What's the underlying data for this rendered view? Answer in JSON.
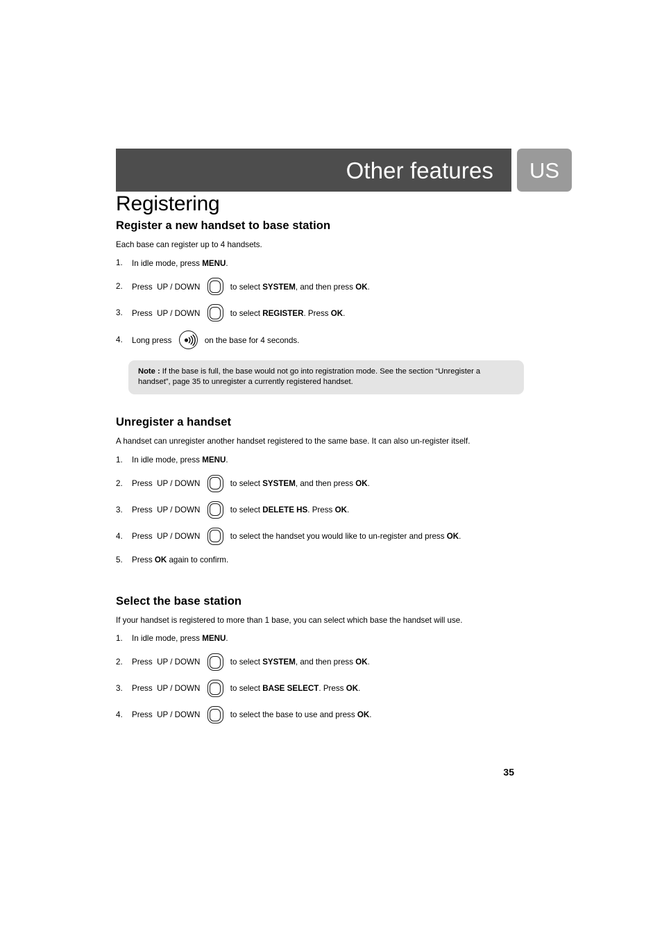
{
  "header": {
    "title": "Other features",
    "region_badge": "US",
    "bar_color": "#4d4d4d",
    "badge_color": "#9a9a9a"
  },
  "chapter_title": "Registering",
  "sections": [
    {
      "heading": "Register a new handset to base station",
      "intro": "Each base can register up to 4 handsets.",
      "steps": [
        {
          "num": "1.",
          "icon": "none",
          "before": "In idle mode, press ",
          "bold1": "MENU",
          "after": "."
        },
        {
          "num": "2.",
          "icon": "navigation-key-icon",
          "before": "Press  UP / DOWN ",
          "mid": " to select ",
          "bold1": "SYSTEM",
          "mid2": ", and then press ",
          "bold2": "OK",
          "after": "."
        },
        {
          "num": "3.",
          "icon": "navigation-key-icon",
          "before": "Press  UP / DOWN ",
          "mid": " to select ",
          "bold1": "REGISTER",
          "mid2": ". Press ",
          "bold2": "OK",
          "after": "."
        },
        {
          "num": "4.",
          "icon": "base-paging-icon",
          "before": "Long press ",
          "mid": " on the base for 4 seconds.",
          "after": ""
        }
      ],
      "note": {
        "label": "Note :",
        "text": " If the base is full, the base would not go into registration mode. See the section “Unregister a handset”, page 35 to unregister a currently registered handset."
      }
    },
    {
      "heading": "Unregister a handset",
      "intro": "A handset can unregister another handset registered to the same base. It can also un-register itself.",
      "steps": [
        {
          "num": "1.",
          "icon": "none",
          "before": "In idle mode, press ",
          "bold1": "MENU",
          "after": "."
        },
        {
          "num": "2.",
          "icon": "navigation-key-icon",
          "before": "Press  UP / DOWN ",
          "mid": " to select ",
          "bold1": "SYSTEM",
          "mid2": ", and then press ",
          "bold2": "OK",
          "after": "."
        },
        {
          "num": "3.",
          "icon": "navigation-key-icon",
          "before": "Press  UP / DOWN ",
          "mid": " to select ",
          "bold1": "DELETE HS",
          "mid2": ". Press ",
          "bold2": "OK",
          "after": "."
        },
        {
          "num": "4.",
          "icon": "navigation-key-icon",
          "before": "Press  UP / DOWN ",
          "mid": " to select the handset you would like to un-register and press ",
          "bold2": "OK",
          "after": "."
        },
        {
          "num": "5.",
          "icon": "none",
          "before": "Press ",
          "bold1": "OK",
          "after": " again to confirm."
        }
      ]
    },
    {
      "heading": "Select the base station",
      "intro": "If your handset is registered to more than 1 base, you can select which base the handset will use.",
      "steps": [
        {
          "num": "1.",
          "icon": "none",
          "before": "In idle mode, press ",
          "bold1": "MENU",
          "after": "."
        },
        {
          "num": "2.",
          "icon": "navigation-key-icon",
          "before": "Press  UP / DOWN ",
          "mid": " to select ",
          "bold1": "SYSTEM",
          "mid2": ", and then press ",
          "bold2": "OK",
          "after": "."
        },
        {
          "num": "3.",
          "icon": "navigation-key-icon",
          "before": "Press  UP / DOWN ",
          "mid": " to select ",
          "bold1": "BASE SELECT",
          "mid2": ". Press ",
          "bold2": "OK",
          "after": "."
        },
        {
          "num": "4.",
          "icon": "navigation-key-icon",
          "before": "Press  UP / DOWN ",
          "mid": " to select the base to use and press ",
          "bold2": "OK",
          "after": "."
        }
      ]
    }
  ],
  "page_number": "35"
}
